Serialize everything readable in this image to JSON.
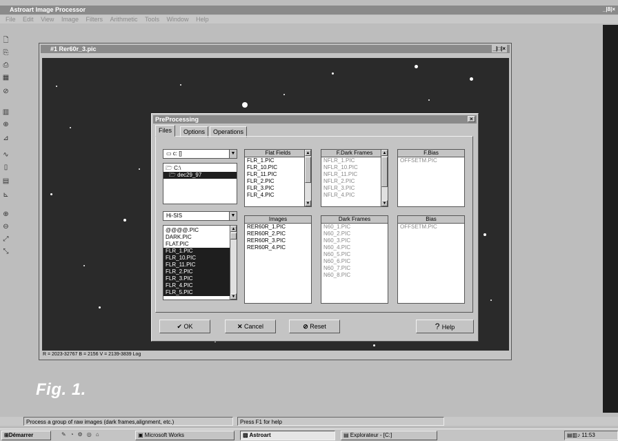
{
  "app": {
    "title": "Astroart Image Processor",
    "controls": "_|8|×",
    "menu": [
      "File",
      "Edit",
      "View",
      "Image",
      "Filters",
      "Arithmetic",
      "Tools",
      "Window",
      "Help"
    ]
  },
  "image_window": {
    "title": "#1 Rer60r_3.pic",
    "controls": "_|□|×",
    "status": "R = 2023-32767   B = 2156   V = 2139-3839 Log"
  },
  "figure_caption": "Fig. 1.",
  "dialog": {
    "title": "PreProcessing",
    "close": "×",
    "tabs": [
      "Files",
      "Options",
      "Operations"
    ],
    "drive": "c: []",
    "folders": [
      "C:\\",
      "dec29_97"
    ],
    "filter": "Hi-SIS",
    "files": [
      "@@@@.PIC",
      "DARK.PIC",
      "FLAT.PIC",
      "FLR_1.PIC",
      "FLR_10.PIC",
      "FLR_11.PIC",
      "FLR_2.PIC",
      "FLR_3.PIC",
      "FLR_4.PIC",
      "FLR_5.PIC"
    ],
    "lists": {
      "flat_fields": {
        "header": "Flat Fields",
        "items": [
          "FLR_1.PIC",
          "FLR_10.PIC",
          "FLR_11.PIC",
          "FLR_2.PIC",
          "FLR_3.PIC",
          "FLR_4.PIC"
        ]
      },
      "f_dark_frames": {
        "header": "F.Dark Frames",
        "items": [
          "NFLR_1.PIC",
          "NFLR_10.PIC",
          "NFLR_11.PIC",
          "NFLR_2.PIC",
          "NFLR_3.PIC",
          "NFLR_4.PIC"
        ]
      },
      "f_bias": {
        "header": "F.Bias",
        "items": [
          "OFFSETM.PIC"
        ]
      },
      "images": {
        "header": "Images",
        "items": [
          "RER60R_1.PIC",
          "RER60R_2.PIC",
          "RER60R_3.PIC",
          "RER60R_4.PIC"
        ]
      },
      "dark_frames": {
        "header": "Dark Frames",
        "items": [
          "N60_1.PIC",
          "N60_2.PIC",
          "N60_3.PIC",
          "N60_4.PIC",
          "N60_5.PIC",
          "N60_6.PIC",
          "N60_7.PIC",
          "N60_8.PIC"
        ]
      },
      "bias": {
        "header": "Bias",
        "items": [
          "OFFSETM.PIC"
        ]
      }
    },
    "buttons": {
      "ok": "OK",
      "cancel": "Cancel",
      "reset": "Reset",
      "help": "Help"
    }
  },
  "statusbar": {
    "hint": "Process a group of raw images (dark frames,alignment, etc.)",
    "help": "Press F1 for help"
  },
  "taskbar": {
    "start": "Démarrer",
    "tasks": [
      "Microsoft Works",
      "Astroart",
      "Explorateur - [C:]"
    ],
    "clock": "11:53"
  }
}
